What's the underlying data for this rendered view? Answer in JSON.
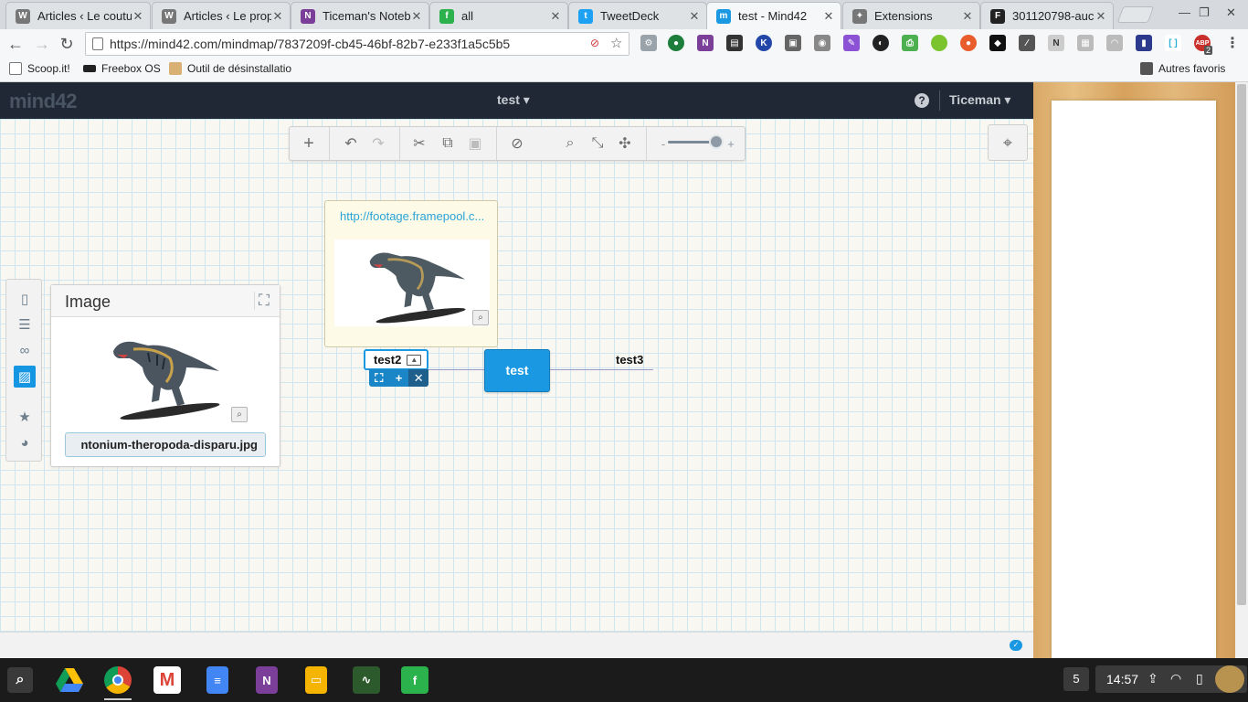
{
  "browser": {
    "tabs": [
      {
        "title": "Articles ‹ Le coutu",
        "favicon": "wordpress-icon",
        "color": "#666"
      },
      {
        "title": "Articles ‹ Le prop",
        "favicon": "wordpress-icon",
        "color": "#666"
      },
      {
        "title": "Ticeman's Noteb",
        "favicon": "onenote-icon",
        "color": "#7b3f9a"
      },
      {
        "title": "all",
        "favicon": "feedly-icon",
        "color": "#2bb24c"
      },
      {
        "title": "TweetDeck",
        "favicon": "twitter-icon",
        "color": "#1da1f2"
      },
      {
        "title": "test - Mind42",
        "favicon": "mind42-icon",
        "color": "#1a99e2"
      },
      {
        "title": "Extensions",
        "favicon": "puzzle-icon",
        "color": "#777"
      },
      {
        "title": "301120798-auc",
        "favicon": "framepool-icon",
        "color": "#222"
      }
    ],
    "url": "https://mind42.com/mindmap/7837209f-cb45-46bf-82b7-e233f1a5c5b5",
    "bookmarks": [
      "Scoop.it!",
      "Freebox OS",
      "Outil de désinstallatio"
    ],
    "other_bookmarks": "Autres favoris",
    "abp_badge": "2"
  },
  "app": {
    "logo": "mind42",
    "map_title": "test ▾",
    "help": "?",
    "user": "Ticeman ▾"
  },
  "image_panel": {
    "title": "Image",
    "filename": "ntonium-theropoda-disparu.jpg"
  },
  "mindmap": {
    "link_url": "http://footage.framepool.c...",
    "root": "test",
    "child_left": "test2",
    "child_right": "test3"
  },
  "taskbar": {
    "window_count": "5",
    "clock": "14:57"
  },
  "colors": {
    "accent": "#1a99e2",
    "header": "#1f2834"
  }
}
